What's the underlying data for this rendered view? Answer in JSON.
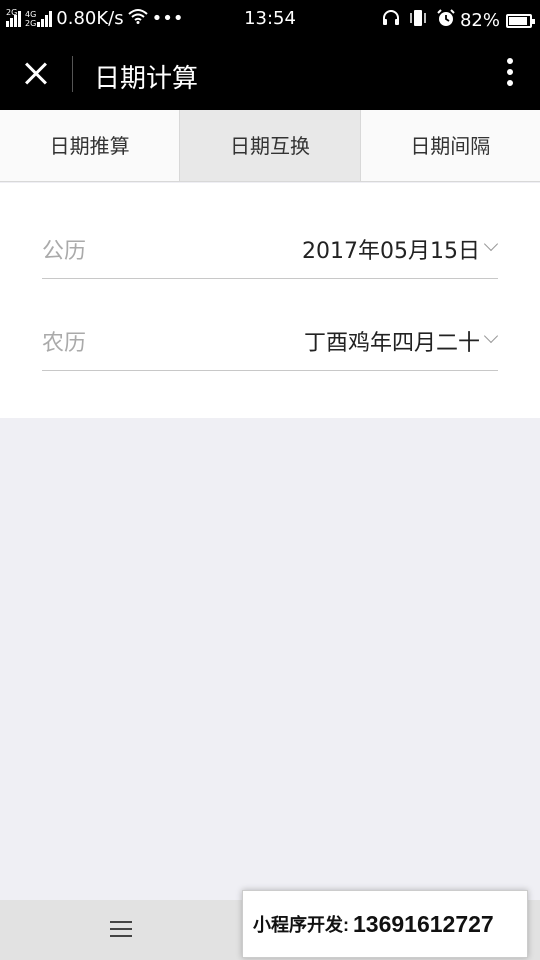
{
  "status_bar": {
    "signal1_label": "2G",
    "signal2_label_top": "4G",
    "signal2_label_bottom": "2G",
    "speed": "0.80K/s",
    "dots": "•••",
    "time": "13:54",
    "battery_percent": "82%",
    "battery_level": 0.82
  },
  "nav": {
    "title": "日期计算"
  },
  "tabs": [
    {
      "label": "日期推算"
    },
    {
      "label": "日期互换"
    },
    {
      "label": "日期间隔"
    }
  ],
  "active_tab": 1,
  "form": {
    "solar_label": "公历",
    "solar_value": "2017年05月15日",
    "lunar_label": "农历",
    "lunar_value": "丁酉鸡年四月二十"
  },
  "promo": {
    "label": "小程序开发:",
    "phone": "13691612727"
  },
  "colors": {
    "header_bg": "#000000",
    "page_bg": "#efeff4",
    "active_tab_bg": "#e8e8e8"
  },
  "icons": [
    "close-icon",
    "more-icon",
    "chevron-down-icon",
    "menu-icon",
    "wifi-icon",
    "headset-icon",
    "vibrate-icon",
    "alarm-icon",
    "battery-icon"
  ]
}
